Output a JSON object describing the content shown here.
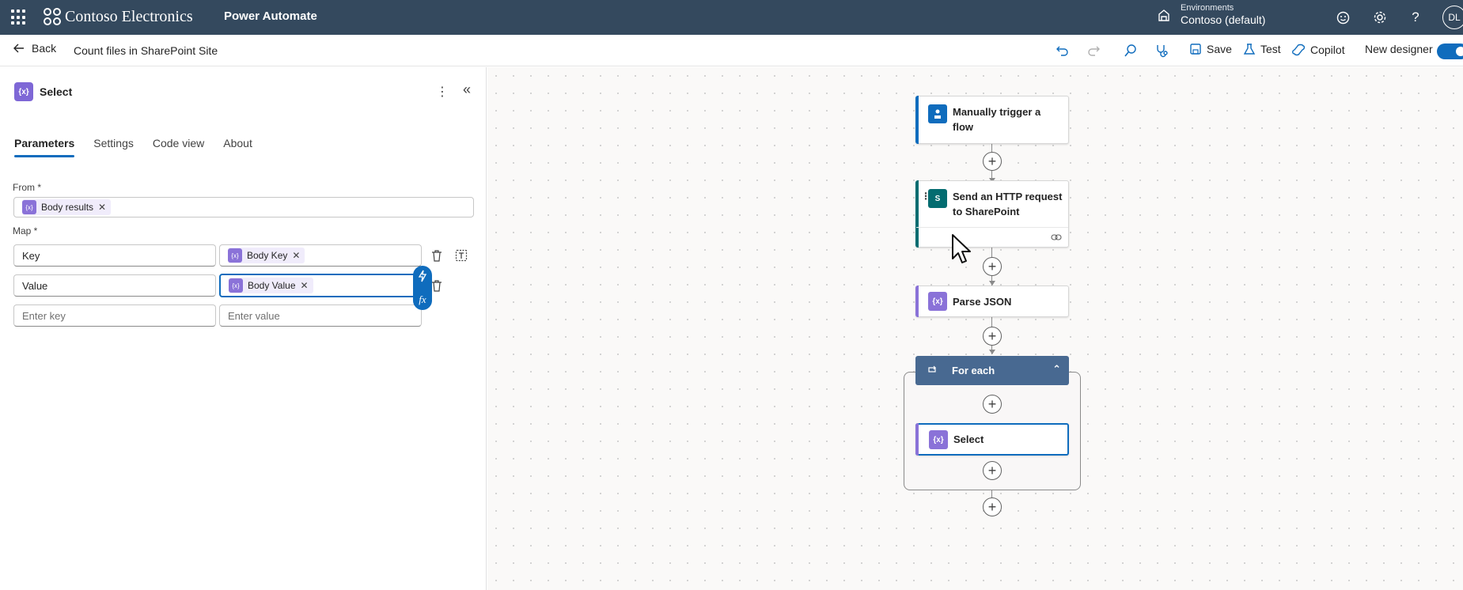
{
  "topbar": {
    "brand_name": "Contoso Electronics",
    "product_name": "Power Automate",
    "environment_label": "Environments",
    "environment_value": "Contoso (default)",
    "avatar_initials": "DL",
    "colors": {
      "background": "#34495e"
    }
  },
  "cmdbar": {
    "back_label": "Back",
    "flow_name": "Count files in SharePoint Site",
    "save_label": "Save",
    "test_label": "Test",
    "copilot_label": "Copilot",
    "new_designer_label": "New designer",
    "new_designer_on": true
  },
  "panel": {
    "title": "Select",
    "tabs": [
      {
        "label": "Parameters",
        "active": true
      },
      {
        "label": "Settings",
        "active": false
      },
      {
        "label": "Code view",
        "active": false
      },
      {
        "label": "About",
        "active": false
      }
    ],
    "from_label": "From *",
    "from_token": "Body results",
    "map_label": "Map *",
    "map_rows": [
      {
        "key": "Key",
        "value_token": "Body Key"
      },
      {
        "key": "Value",
        "value_token": "Body Value"
      }
    ],
    "key_placeholder": "Enter key",
    "value_placeholder": "Enter value",
    "expr_icons": [
      "lightning-icon",
      "fx-icon"
    ]
  },
  "flow": {
    "nodes": [
      {
        "title_line1": "Manually trigger a",
        "title_line2": "flow",
        "icon": "person-trigger-icon",
        "color": "#0f6cbd"
      },
      {
        "title_line1": "Send an HTTP request",
        "title_line2": "to SharePoint",
        "icon": "sharepoint-icon",
        "color": "#036c70"
      },
      {
        "title_line1": "Parse JSON",
        "title_line2": "",
        "icon": "data-operation-icon",
        "color": "#8a72d8"
      },
      {
        "title_line1": "For each",
        "title_line2": "",
        "icon": "loop-icon",
        "color": "#486991"
      },
      {
        "title_line1": "Select",
        "title_line2": "",
        "icon": "data-operation-icon",
        "color": "#8a72d8"
      }
    ],
    "accent": "#0f6cbd"
  }
}
